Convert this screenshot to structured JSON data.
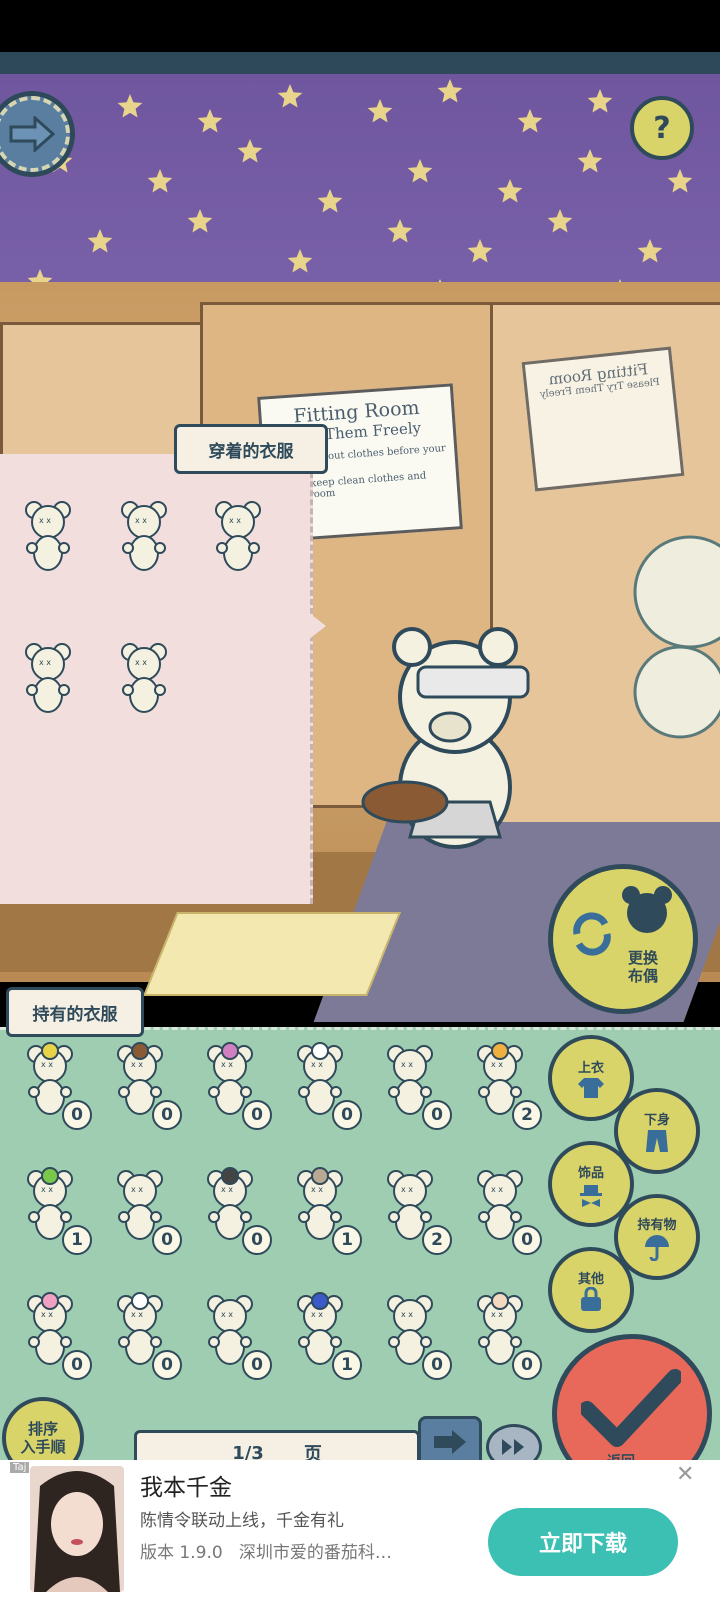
{
  "worn_panel": {
    "title": "穿着的衣服",
    "items": [
      {
        "icon": "bear-apron-icon"
      },
      {
        "icon": "bear-jacket-icon"
      },
      {
        "icon": "bear-skirt-icon"
      },
      {
        "icon": "bear-tray-icon"
      },
      {
        "icon": "bear-bandage-icon"
      }
    ]
  },
  "owned_panel": {
    "title": "持有的衣服",
    "items": [
      {
        "icon": "bear-yellow-hat-icon",
        "count": "0"
      },
      {
        "icon": "bear-aviator-cap-icon",
        "count": "0"
      },
      {
        "icon": "bear-pink-glasses-icon",
        "count": "0"
      },
      {
        "icon": "bear-flower-hat-icon",
        "count": "0"
      },
      {
        "icon": "bear-scarf-icon",
        "count": "0"
      },
      {
        "icon": "bear-party-hat-icon",
        "count": "2"
      },
      {
        "icon": "bear-sprout-icon",
        "count": "1"
      },
      {
        "icon": "bear-plain-icon",
        "count": "0"
      },
      {
        "icon": "bear-sunglasses-icon",
        "count": "0"
      },
      {
        "icon": "bear-headband-icon",
        "count": "1"
      },
      {
        "icon": "bear-mask-icon",
        "count": "2"
      },
      {
        "icon": "bear-pink-bow-icon",
        "count": "0"
      },
      {
        "icon": "bear-pink-flower-icon",
        "count": "0"
      },
      {
        "icon": "bear-chef-hat-icon",
        "count": "0"
      },
      {
        "icon": "bear-tie-icon",
        "count": "0"
      },
      {
        "icon": "bear-blue-beanie-icon",
        "count": "1"
      },
      {
        "icon": "bear-bag-icon",
        "count": "0"
      },
      {
        "icon": "bear-curly-hair-icon",
        "count": "0"
      }
    ]
  },
  "categories": {
    "tops": "上衣",
    "bottoms": "下身",
    "accessories": "饰品",
    "held": "持有物",
    "other": "其他"
  },
  "change_doll": "更换\n布偶",
  "sort_button": "排序\n入手順",
  "pagination": {
    "page": "1/3",
    "unit": "页"
  },
  "confirm_label": "返回",
  "signs": {
    "left_title": "Fitting Room",
    "left_sub": "Try Them Freely",
    "left_rule1": "Don't take out clothes before your bill.",
    "left_rule2": "Please keep clean clothes and fitting room",
    "right_title": "Fitting Room",
    "right_sub": "Please Try Them Freely"
  },
  "ad": {
    "tag": "Taj",
    "title": "我本千金",
    "desc": "陈情令联动上线，千金有礼",
    "version": "版本 1.9.0",
    "publisher": "深圳市爱的番茄科…",
    "download": "立即下载",
    "close": "✕"
  },
  "colors": {
    "wall": "#6e559e",
    "star": "#e8d48a",
    "worn_bg": "#f1dedd",
    "owned_bg": "#9ecdb2",
    "outline": "#2f4a5a",
    "category_btn": "#d9d46a",
    "confirm": "#e8685a",
    "ad_button": "#3cc0b4"
  }
}
